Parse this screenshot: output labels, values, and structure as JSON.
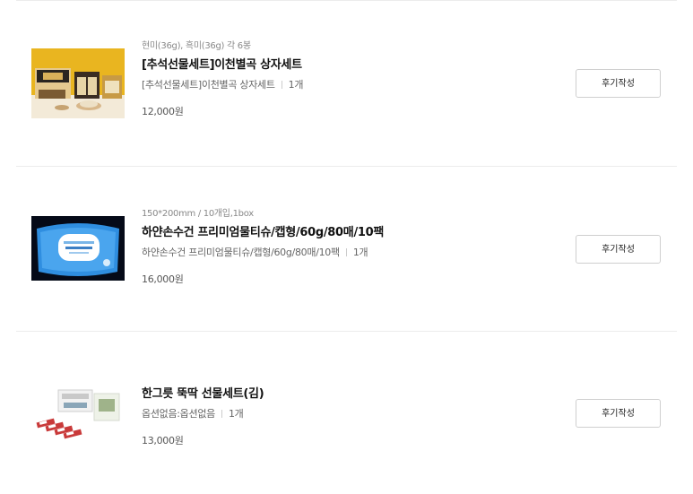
{
  "items": [
    {
      "option": "현미(36g), 흑미(36g) 각 6봉",
      "title": "[추석선물세트]이천별곡 상자세트",
      "subtitle": "[추석선물세트]이천별곡 상자세트",
      "quantity": "1개",
      "price": "12,000원",
      "review_button": "후기작성"
    },
    {
      "option": "150*200mm / 10개입,1box",
      "title": "하얀손수건 프리미엄물티슈/캡형/60g/80매/10팩",
      "subtitle": "하얀손수건 프리미엄물티슈/캡형/60g/80매/10팩",
      "quantity": "1개",
      "price": "16,000원",
      "review_button": "후기작성"
    },
    {
      "title": "한그릇 뚝딱 선물세트(김)",
      "subtitle": "옵션없음:옵션없음",
      "quantity": "1개",
      "price": "13,000원",
      "review_button": "후기작성"
    }
  ]
}
